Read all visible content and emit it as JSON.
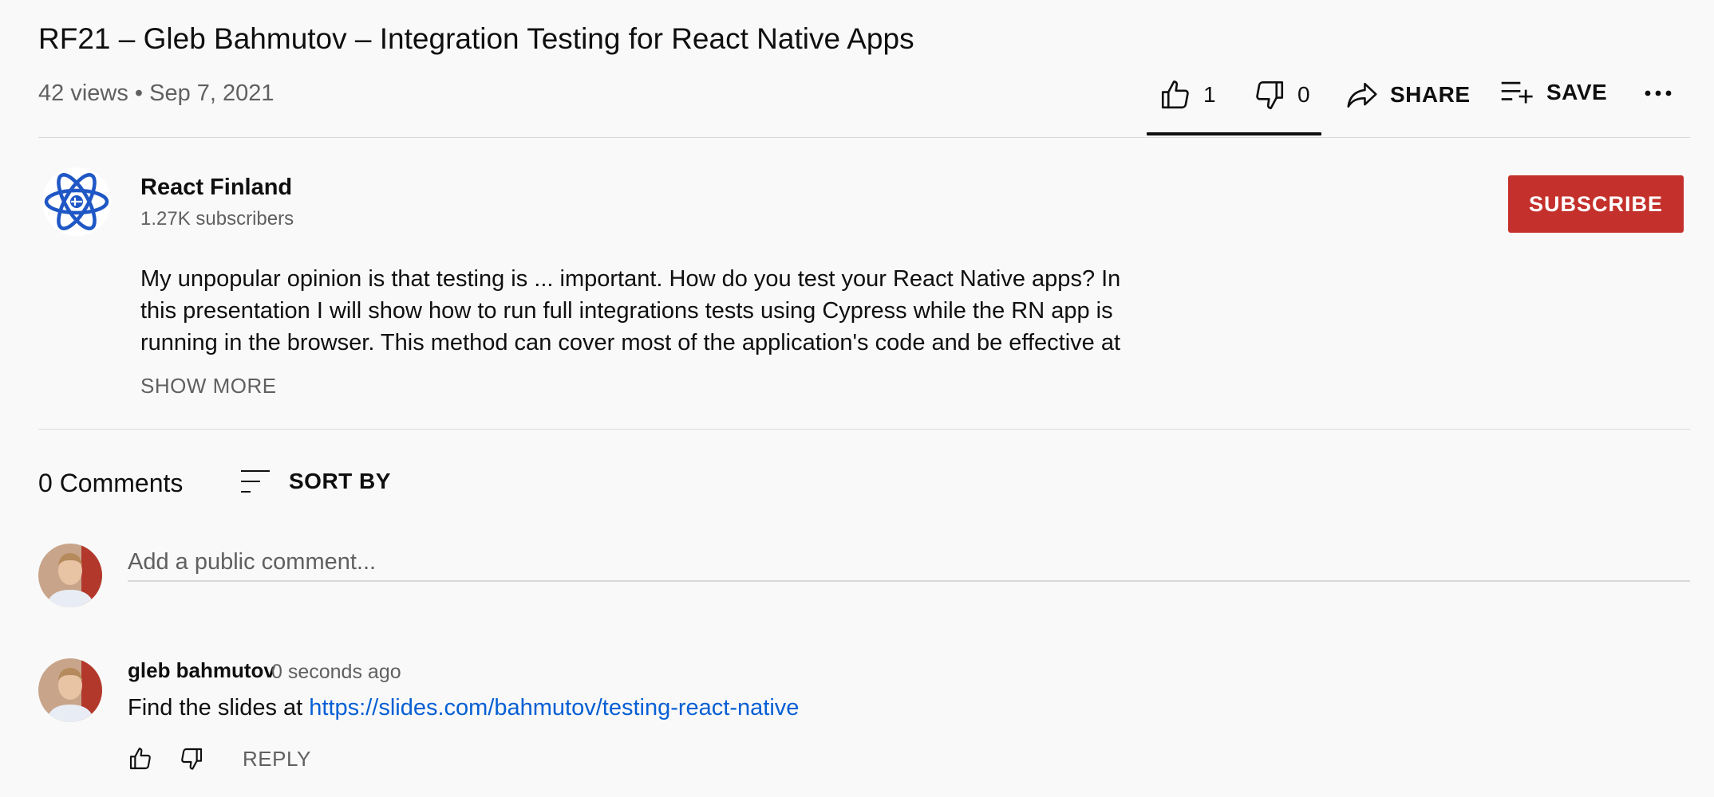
{
  "video": {
    "title": "RF21 – Gleb Bahmutov – Integration Testing for React Native Apps",
    "meta": "42 views • Sep 7, 2021"
  },
  "actions": {
    "like_count": "1",
    "dislike_count": "0",
    "share_label": "SHARE",
    "save_label": "SAVE",
    "like_ratio": 1.0
  },
  "channel": {
    "name": "React Finland",
    "subscribers": "1.27K subscribers",
    "subscribe_label": "SUBSCRIBE",
    "logo_icon": "react-atom-icon"
  },
  "description": {
    "lines": [
      "My unpopular opinion is that testing is ... important. How do you test your React Native apps? In",
      "this presentation I will show how to run full integrations tests using Cypress while the RN app is",
      "running in the browser. This method can cover most of the application's code and be effective at"
    ],
    "show_more_label": "SHOW MORE"
  },
  "comments": {
    "count_label": "0 Comments",
    "sort_label": "SORT BY",
    "input_placeholder": "Add a public comment...",
    "items": [
      {
        "author": "gleb bahmutov",
        "time": "0 seconds ago",
        "text_prefix": "Find the slides at ",
        "link": "https://slides.com/bahmutov/testing-react-native",
        "reply_label": "REPLY"
      }
    ]
  },
  "colors": {
    "subscribe": "#c4302b",
    "link": "#065fd4",
    "text": "#0f0f0f",
    "muted": "#606060",
    "background": "#f9f9f9"
  }
}
